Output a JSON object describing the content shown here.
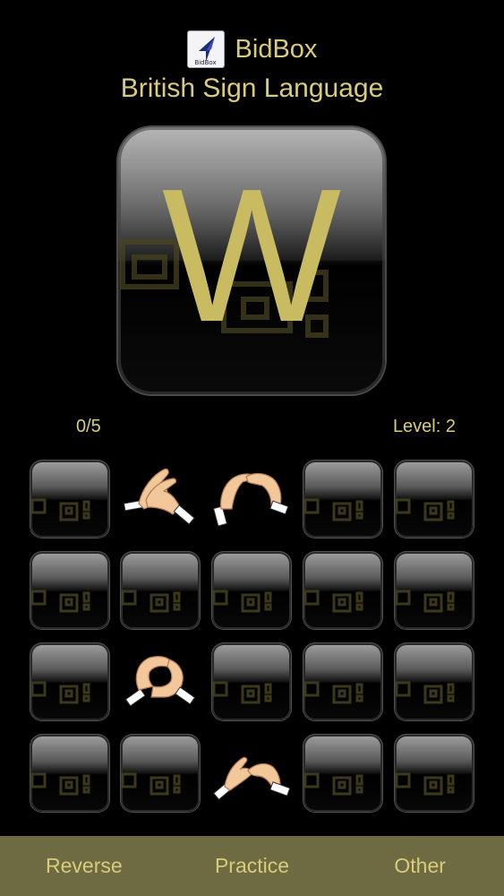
{
  "header": {
    "app_name": "BidBox",
    "logo_text": "BidBox",
    "subtitle": "British Sign Language"
  },
  "current_card": {
    "letter": "W"
  },
  "status": {
    "score": "0/5",
    "level": "Level: 2"
  },
  "grid": {
    "rows": 4,
    "cols": 5,
    "tiles": [
      [
        "card",
        "sign-clap",
        "sign-bridge",
        "card",
        "card"
      ],
      [
        "card",
        "card",
        "card",
        "card",
        "card"
      ],
      [
        "card",
        "sign-circle",
        "card",
        "card",
        "card"
      ],
      [
        "card",
        "card",
        "sign-pinch",
        "card",
        "card"
      ]
    ]
  },
  "tabs": [
    "Reverse",
    "Practice",
    "Other"
  ],
  "colors": {
    "accent": "#d8cc7c",
    "tab_bar": "#6e6a42",
    "background": "#000000"
  }
}
